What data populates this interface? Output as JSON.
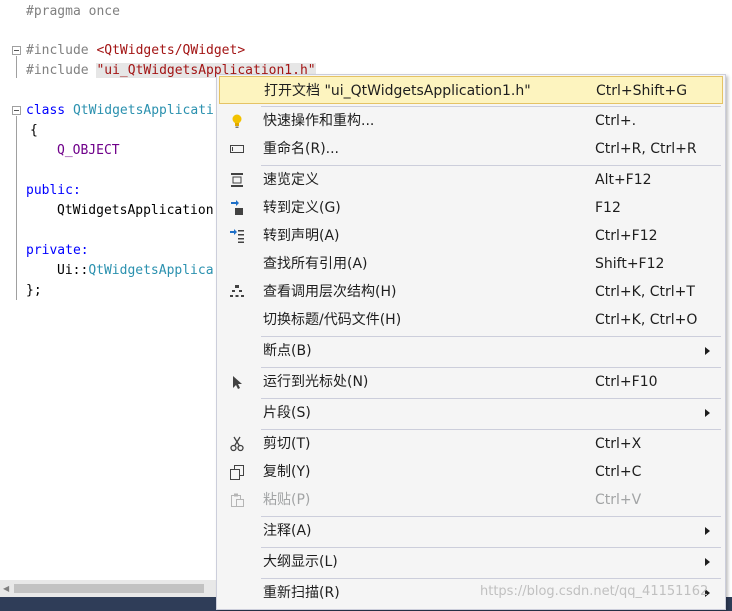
{
  "editor": {
    "lines": {
      "l1": "#pragma once",
      "l3_pp": "#include ",
      "l3_path": "<QtWidgets/QWidget>",
      "l4_pp": "#include ",
      "l4_path": "\"ui_QtWidgetsApplication1.h\"",
      "l6_kw": "class ",
      "l6_type": "QtWidgetsApplicati",
      "l7": "{",
      "l8": "Q_OBJECT",
      "l10": "public:",
      "l11": "QtWidgetsApplication",
      "l13": "private:",
      "l14_a": "Ui::",
      "l14_b": "QtWidgetsApplica",
      "l15": "};"
    }
  },
  "context_menu": {
    "items": [
      {
        "label": "打开文档 \"ui_QtWidgetsApplication1.h\"",
        "shortcut": "Ctrl+Shift+G",
        "icon": "none"
      },
      {
        "label": "快速操作和重构...",
        "shortcut": "Ctrl+.",
        "icon": "lightbulb-icon"
      },
      {
        "label": "重命名(R)...",
        "shortcut": "Ctrl+R, Ctrl+R",
        "icon": "rename-icon"
      },
      {
        "label": "速览定义",
        "shortcut": "Alt+F12",
        "icon": "peek-definition-icon"
      },
      {
        "label": "转到定义(G)",
        "shortcut": "F12",
        "icon": "go-to-definition-icon"
      },
      {
        "label": "转到声明(A)",
        "shortcut": "Ctrl+F12",
        "icon": "go-to-declaration-icon"
      },
      {
        "label": "查找所有引用(A)",
        "shortcut": "Shift+F12",
        "icon": "none"
      },
      {
        "label": "查看调用层次结构(H)",
        "shortcut": "Ctrl+K, Ctrl+T",
        "icon": "call-hierarchy-icon"
      },
      {
        "label": "切换标题/代码文件(H)",
        "shortcut": "Ctrl+K, Ctrl+O",
        "icon": "none"
      },
      {
        "label": "断点(B)",
        "shortcut": "",
        "icon": "none"
      },
      {
        "label": "运行到光标处(N)",
        "shortcut": "Ctrl+F10",
        "icon": "run-to-cursor-icon"
      },
      {
        "label": "片段(S)",
        "shortcut": "",
        "icon": "none"
      },
      {
        "label": "剪切(T)",
        "shortcut": "Ctrl+X",
        "icon": "cut-icon"
      },
      {
        "label": "复制(Y)",
        "shortcut": "Ctrl+C",
        "icon": "copy-icon"
      },
      {
        "label": "粘贴(P)",
        "shortcut": "Ctrl+V",
        "icon": "paste-icon"
      },
      {
        "label": "注释(A)",
        "shortcut": "",
        "icon": "none"
      },
      {
        "label": "大纲显示(L)",
        "shortcut": "",
        "icon": "none"
      },
      {
        "label": "重新扫描(R)",
        "shortcut": "",
        "icon": "none"
      }
    ]
  },
  "watermark": "https://blog.csdn.net/qq_41151162",
  "colors": {
    "selected_bg": "#fdf4bf",
    "selected_border": "#e5c365",
    "menu_bg": "#f5f5f5",
    "keyword": "#0000ff",
    "string": "#a31515",
    "type": "#2b91af"
  }
}
